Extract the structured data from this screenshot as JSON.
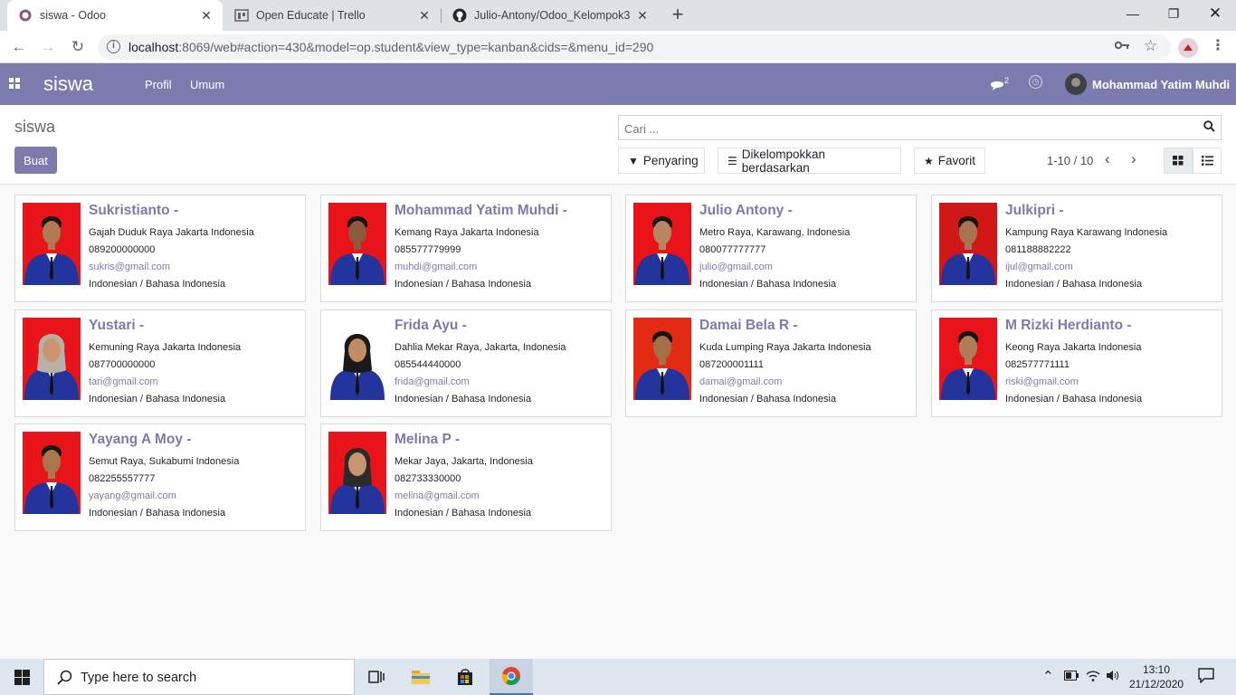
{
  "browser": {
    "tabs": [
      {
        "title": "siswa - Odoo",
        "icon": "odoo-icon",
        "active": true
      },
      {
        "title": "Open Educate | Trello",
        "icon": "trello-icon",
        "active": false
      },
      {
        "title": "Julio-Antony/Odoo_Kelompok3",
        "icon": "github-icon",
        "active": false
      }
    ],
    "new_tab": "+",
    "url_host": "localhost",
    "url_rest": ":8069/web#action=430&model=op.student&view_type=kanban&cids=&menu_id=290"
  },
  "odoo": {
    "brand": "siswa",
    "menu": [
      "Profil",
      "Umum"
    ],
    "chat_count": "2",
    "user_name": "Mohammad Yatim Muhdi",
    "accent": "#7c7bad"
  },
  "control_panel": {
    "breadcrumb": "siswa",
    "create_label": "Buat",
    "search_placeholder": "Cari ...",
    "filter_label": "Penyaring",
    "groupby_label": "Dikelompokkan berdasarkan",
    "favorite_label": "Favorit",
    "pager": "1-10 / 10"
  },
  "students": [
    {
      "name": "Sukristianto -",
      "address": "Gajah Duduk Raya Jakarta Indonesia",
      "phone": "089200000000",
      "email": "sukris@gmail.com",
      "lang": "Indonesian / Bahasa Indonesia",
      "bg": "#e8141a",
      "skin": "#b07a55",
      "hijab": false
    },
    {
      "name": "Mohammad Yatim Muhdi -",
      "address": "Kemang Raya Jakarta Indonesia",
      "phone": "085577779999",
      "email": "muhdi@gmail.com",
      "lang": "Indonesian / Bahasa Indonesia",
      "bg": "#e8141a",
      "skin": "#8c5a3c",
      "hijab": false
    },
    {
      "name": "Julio Antony -",
      "address": "Metro Raya, Karawang, Indonesia",
      "phone": "080077777777",
      "email": "julio@gmail.com",
      "lang": "Indonesian / Bahasa Indonesia",
      "bg": "#e8141a",
      "skin": "#b88660",
      "hijab": false
    },
    {
      "name": "Julkipri -",
      "address": "Kampung Raya Karawang Indonesia",
      "phone": "081188882222",
      "email": "ijul@gmail.com",
      "lang": "Indonesian / Bahasa Indonesia",
      "bg": "#d01818",
      "skin": "#a7744f",
      "hijab": false
    },
    {
      "name": "Yustari -",
      "address": "Kemuning Raya Jakarta Indonesia",
      "phone": "087700000000",
      "email": "tari@gmail.com",
      "lang": "Indonesian / Bahasa Indonesia",
      "bg": "#e8141a",
      "skin": "#c9956e",
      "hijab": true,
      "hijab_color": "#b7b0a5"
    },
    {
      "name": "Frida Ayu -",
      "address": "Dahlia Mekar Raya, Jakarta, Indonesia",
      "phone": "085544440000",
      "email": "frida@gmail.com",
      "lang": "Indonesian / Bahasa Indonesia",
      "bg": "#ffffff",
      "skin": "#c38d63",
      "hijab": true,
      "hijab_color": "#1a1a1a"
    },
    {
      "name": "Damai Bela R -",
      "address": "Kuda Lumping Raya Jakarta Indonesia",
      "phone": "087200001111",
      "email": "damai@gmail.com",
      "lang": "Indonesian / Bahasa Indonesia",
      "bg": "#e32a12",
      "skin": "#a46e47",
      "hijab": false
    },
    {
      "name": "M Rizki Herdianto -",
      "address": "Keong Raya Jakarta Indonesia",
      "phone": "082577771111",
      "email": "riski@gmail.com",
      "lang": "Indonesian / Bahasa Indonesia",
      "bg": "#e8141a",
      "skin": "#b07d58",
      "hijab": false
    },
    {
      "name": "Yayang A Moy -",
      "address": "Semut Raya, Sukabumi Indonesia",
      "phone": "082255557777",
      "email": "yayang@gmail.com",
      "lang": "Indonesian / Bahasa Indonesia",
      "bg": "#e8141a",
      "skin": "#a8764f",
      "hijab": false
    },
    {
      "name": "Melina P -",
      "address": "Mekar Jaya, Jakarta, Indonesia",
      "phone": "082733330000",
      "email": "melina@gmail.com",
      "lang": "Indonesian / Bahasa Indonesia",
      "bg": "#e8141a",
      "skin": "#c8966e",
      "hijab": true,
      "hijab_color": "#2b2b2b"
    }
  ],
  "taskbar": {
    "search_placeholder": "Type here to search",
    "time": "13:10",
    "date": "21/12/2020"
  }
}
